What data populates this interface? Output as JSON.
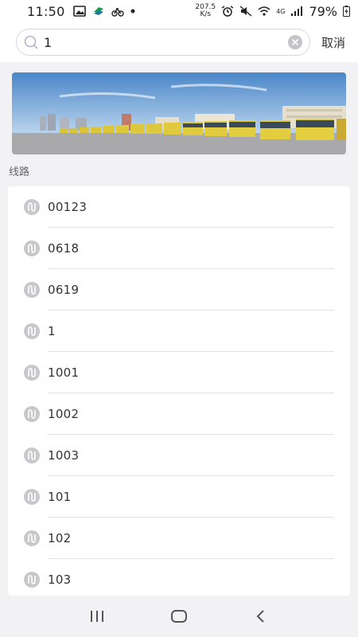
{
  "status_bar": {
    "time": "11:50",
    "speed_value": "207.5",
    "speed_unit": "K/s",
    "network": "4G",
    "battery": "79%"
  },
  "search": {
    "value": "1",
    "cancel_label": "取消"
  },
  "section": {
    "title": "线路"
  },
  "routes": [
    {
      "name": "00123"
    },
    {
      "name": "0618"
    },
    {
      "name": "0619"
    },
    {
      "name": "1"
    },
    {
      "name": "1001"
    },
    {
      "name": "1002"
    },
    {
      "name": "1003"
    },
    {
      "name": "101"
    },
    {
      "name": "102"
    },
    {
      "name": "103"
    }
  ],
  "colors": {
    "icon_gray": "#c8c8cc",
    "search_border": "#d9d4e8",
    "background": "#f2f2f4"
  }
}
